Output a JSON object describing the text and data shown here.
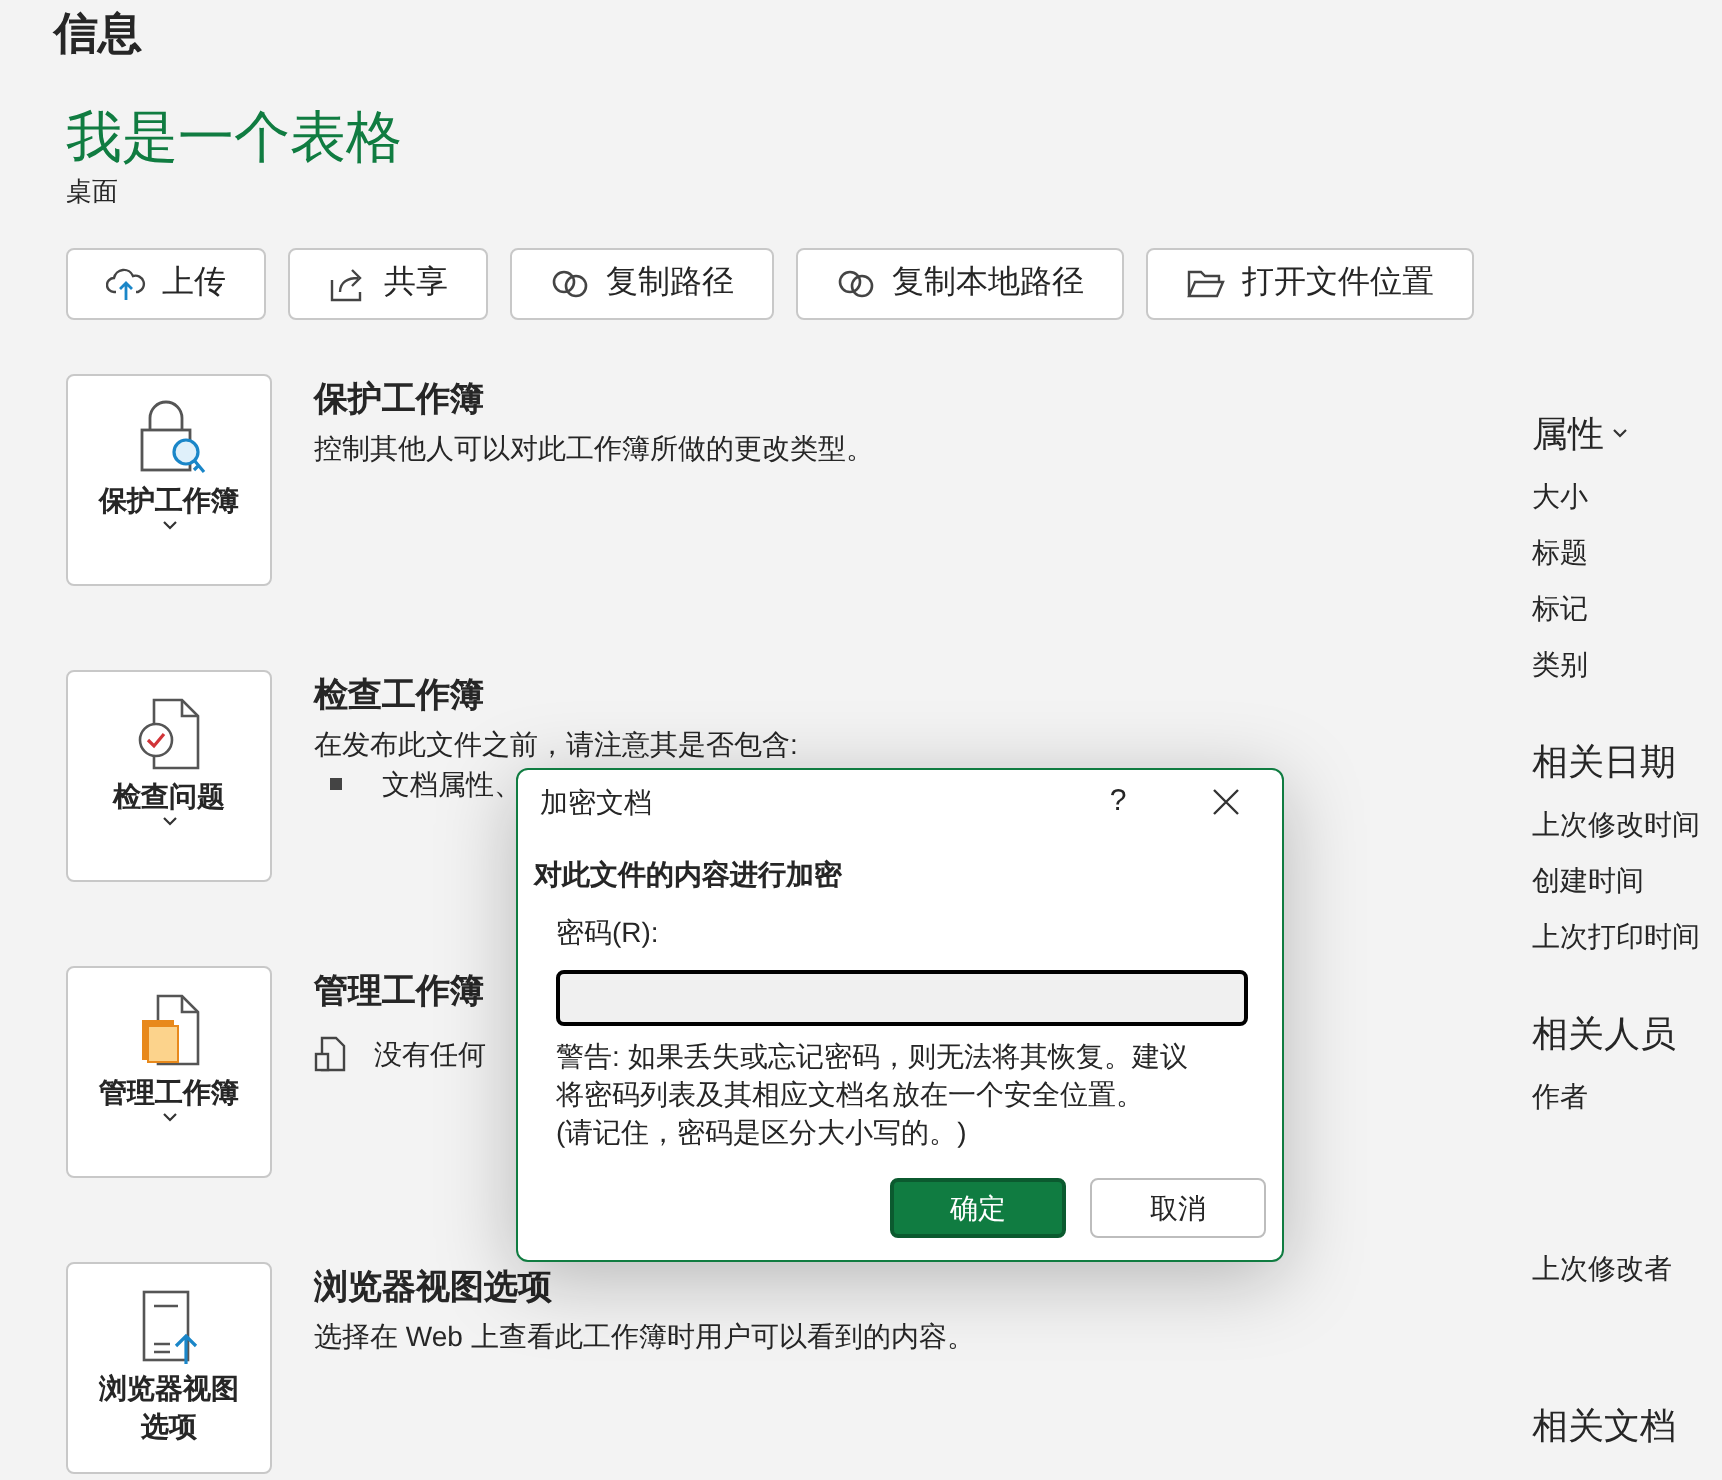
{
  "page_title": "信息",
  "file": {
    "name": "我是一个表格",
    "location": "桌面"
  },
  "actions": [
    {
      "label": "上传",
      "kind": "upload"
    },
    {
      "label": "共享",
      "kind": "share"
    },
    {
      "label": "复制路径",
      "kind": "link"
    },
    {
      "label": "复制本地路径",
      "kind": "link"
    },
    {
      "label": "打开文件位置",
      "kind": "folder"
    }
  ],
  "sections": [
    {
      "button_label": "保护工作簿",
      "chevron": true,
      "kind": "lock",
      "title": "保护工作簿",
      "description": "控制其他人可以对此工作簿所做的更改类型。"
    },
    {
      "button_label": "检查问题",
      "chevron": true,
      "kind": "inspect",
      "title": "检查工作簿",
      "description": "在发布此文件之前，请注意其是否包含:",
      "bullets": [
        "文档属性、"
      ]
    },
    {
      "button_label": "管理工作簿",
      "chevron": true,
      "kind": "manage",
      "title": "管理工作簿",
      "notes": [
        "没有任何"
      ]
    },
    {
      "button_label": "浏览器视图选项",
      "chevron": false,
      "kind": "browser",
      "title": "浏览器视图选项",
      "description": "选择在 Web 上查看此工作簿时用户可以看到的内容。"
    }
  ],
  "properties": [
    {
      "heading": "属性",
      "dropdown": true,
      "kind": "list",
      "items": [
        "大小",
        "标题",
        "标记",
        "类别"
      ]
    },
    {
      "heading": "相关日期",
      "dropdown": false,
      "kind": "list",
      "items": [
        "上次修改时间",
        "创建时间",
        "上次打印时间"
      ]
    },
    {
      "heading": "相关人员",
      "dropdown": false,
      "kind": "people",
      "items": [
        "作者",
        "上次修改者"
      ]
    },
    {
      "heading": "相关文档",
      "dropdown": false
    }
  ],
  "dialog": {
    "title": "加密文档",
    "help": "?",
    "heading": "对此文件的内容进行加密",
    "field_label": "密码(R):",
    "warning": [
      "警告: 如果丢失或忘记密码，则无法将其恢复。建议",
      "将密码列表及其相应文档名放在一个安全位置。",
      "(请记住，密码是区分大小写的。)"
    ],
    "buttons": [
      {
        "label": "确定",
        "default": true
      },
      {
        "label": "取消",
        "default": false
      }
    ]
  }
}
